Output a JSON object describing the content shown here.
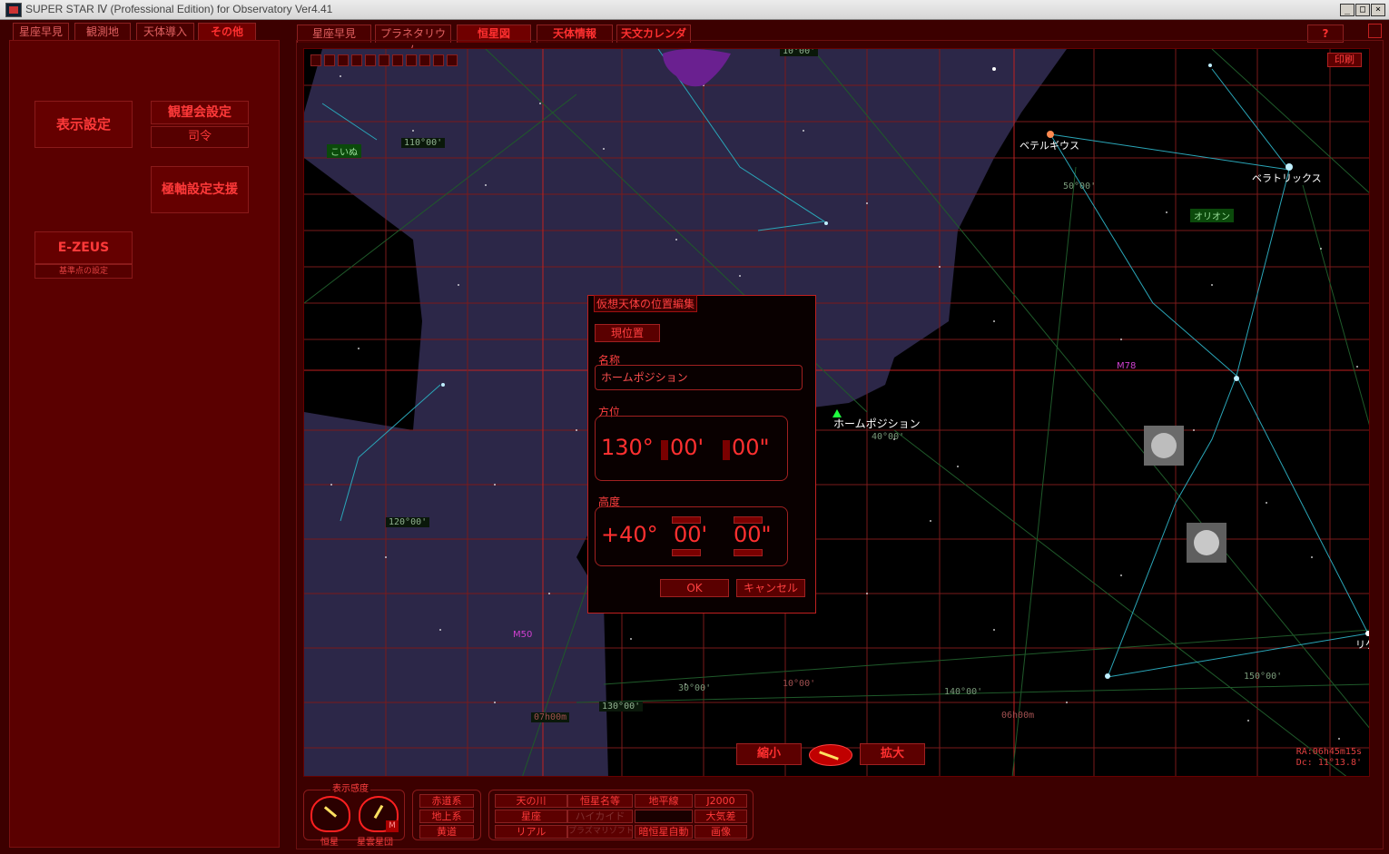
{
  "window": {
    "title": "SUPER STAR Ⅳ (Professional Edition) for Observatory Ver4.41",
    "buttons": {
      "minimize": "_",
      "maximize": "□",
      "close": "×"
    }
  },
  "left_tabs": [
    "星座早見",
    "観測地",
    "天体導入",
    "その他"
  ],
  "left_active": "その他",
  "left_panel": {
    "display_settings": "表示設定",
    "viewing_settings": "観望会設定",
    "commander": "司令",
    "polar_support": "極軸設定支援",
    "ezeus": "E-ZEUS",
    "ezeus_sub": "基準点の設定"
  },
  "main_tabs": [
    "星座早見",
    "プラネタリウム",
    "恒星図",
    "天体情報",
    "天文カレンダー"
  ],
  "main_active": "恒星図",
  "help_label": "?",
  "map": {
    "print": "印刷",
    "stars": {
      "betelgeuse": "ベテルギウス",
      "bellatrix": "ベラトリックス",
      "rigel": "リゲ",
      "home": "ホームポジション"
    },
    "constellations": {
      "canis_minor": "こいぬ",
      "orion": "オリオン"
    },
    "messier": {
      "m78": "M78",
      "m50": "M50"
    },
    "coords": {
      "c110": "110°00'",
      "c120": "120°00'",
      "c50": "50°00'",
      "c40": "40°00'",
      "c10": "10°00'",
      "c30": "30°00'",
      "c130": "130°00'",
      "c140": "140°00'",
      "c150": "150°00'",
      "ra07": "07h00m",
      "ra06": "06h00m",
      "ctop": "10°00'"
    },
    "zoom_out": "縮小",
    "zoom_in": "拡大",
    "ra": "RA:06h45m15s",
    "dec": "Dc: 11°13.8'"
  },
  "dialog": {
    "title": "仮想天体の位置編集",
    "current_pos": "現位置",
    "name_label": "名称",
    "name_value": "ホームポジション",
    "azimuth_label": "方位",
    "az_deg": "130°",
    "az_min": "00'",
    "az_sec": "00\"",
    "altitude_label": "高度",
    "alt_deg": "+40°",
    "alt_min": "00'",
    "alt_sec": "00\"",
    "ok": "OK",
    "cancel": "キャンセル"
  },
  "bottom": {
    "sensitivity_label": "表示感度",
    "gauge_star": "恒星",
    "gauge_nebula": "星雲星団",
    "gauge_m": "M",
    "coord_buttons": [
      "赤道系",
      "地上系",
      "黄道"
    ],
    "toggles": [
      "天の川",
      "恒星名等",
      "地平線",
      "J2000",
      "星座",
      "ハイカイド",
      "",
      "大気差",
      "リアル",
      "プラズマリゾフト",
      "暗恒星自動",
      "画像"
    ]
  },
  "colors": {
    "bg": "#3c0000",
    "accent": "#ff3030",
    "sky_purple": "#2c2748"
  }
}
